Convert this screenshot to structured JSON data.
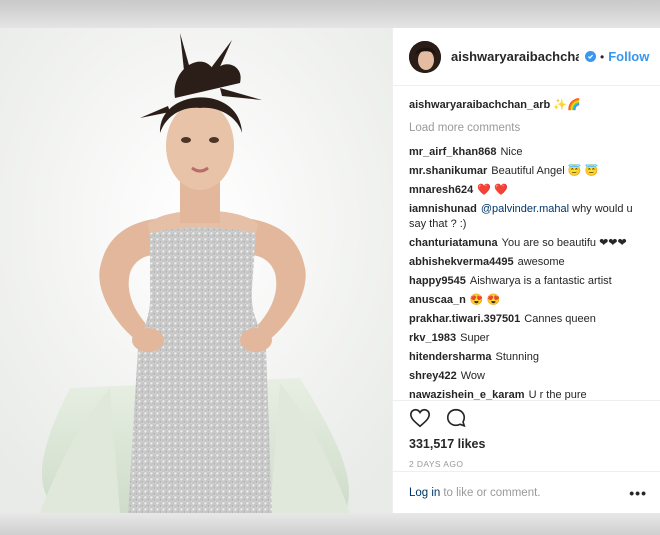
{
  "header": {
    "username": "aishwaryaraibachchan_arb",
    "follow_label": "Follow",
    "separator": "•"
  },
  "caption": {
    "username": "aishwaryaraibachchan_arb",
    "text": "✨🌈"
  },
  "load_more_label": "Load more comments",
  "comments": [
    {
      "user": "mr_airf_khan868",
      "text": "Nice"
    },
    {
      "user": "mr.shanikumar",
      "text": "Beautiful Angel 😇 😇"
    },
    {
      "user": "mnaresh624",
      "text": "❤️ ❤️"
    },
    {
      "user": "iamnishunad",
      "mention": "@palvinder.mahal",
      "text": "why would u say that ? :)"
    },
    {
      "user": "chanturiatamuna",
      "text": "You are so beautifu ❤❤❤"
    },
    {
      "user": "abhishekverma4495",
      "text": "awesome"
    },
    {
      "user": "happy9545",
      "text": "Aishwarya is a fantastic artist"
    },
    {
      "user": "anuscaa_n",
      "text": "😍 😍"
    },
    {
      "user": "prakhar.tiwari.397501",
      "text": "Cannes queen"
    },
    {
      "user": "rkv_1983",
      "text": "Super"
    },
    {
      "user": "hitendersharma",
      "text": "Stunning"
    },
    {
      "user": "shrey422",
      "text": "Wow"
    },
    {
      "user": "nawazishein_e_karam",
      "text": "U r the pure"
    }
  ],
  "actions": {
    "likes": "331,517 likes",
    "timestamp": "2 DAYS AGO"
  },
  "footer": {
    "login_label": "Log in",
    "login_suffix": "to like or comment.",
    "more_label": "•••"
  },
  "colors": {
    "accent": "#3897f0",
    "link": "#003569",
    "muted": "#999999"
  },
  "icons": [
    "verified-badge-icon",
    "heart-icon",
    "comment-icon",
    "more-options-icon"
  ]
}
